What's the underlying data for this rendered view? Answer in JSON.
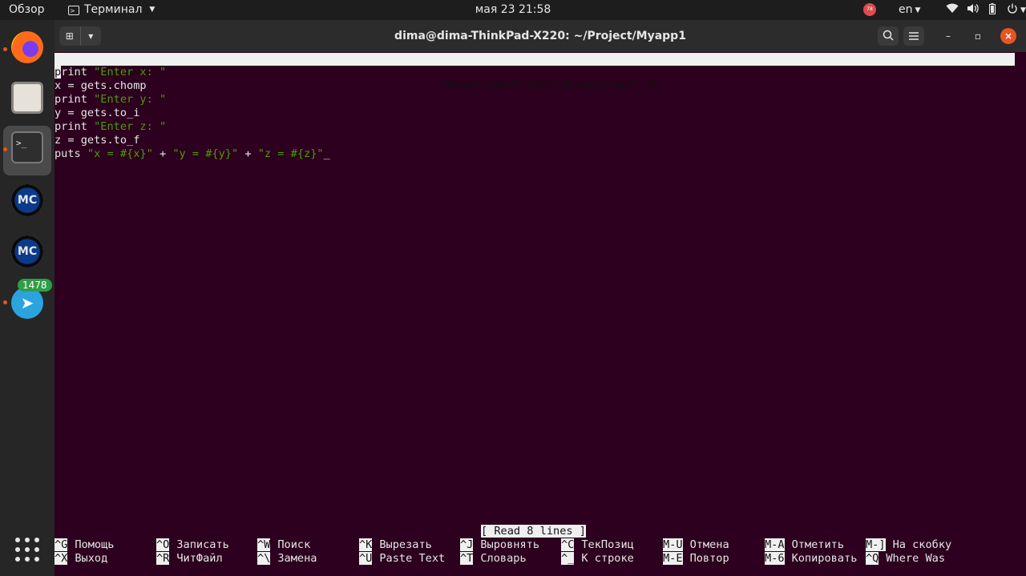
{
  "topbar": {
    "overview": "Обзор",
    "app": "Терминал",
    "clock": "мая 23  21:58",
    "rec_badge": "78",
    "lang": "en"
  },
  "dock": {
    "badge": "1478",
    "terminal_glyph": ">_",
    "mc_label": "MC"
  },
  "window": {
    "title": "dima@dima-ThinkPad-X220: ~/Project/Myapp1"
  },
  "nano": {
    "version": "GNU nano 4.8",
    "path": "/home/dima/Project/Myapp1/app7.rb",
    "status": "[ Read 8 lines ]",
    "code": [
      [
        {
          "t": "print",
          "c": "kw"
        },
        {
          "t": " \"Enter x: \"",
          "c": "str"
        }
      ],
      [
        {
          "t": "x = gets.chomp",
          "c": "kw"
        }
      ],
      [
        {
          "t": "print",
          "c": "kw"
        },
        {
          "t": " \"Enter y: \"",
          "c": "str"
        }
      ],
      [
        {
          "t": "y = gets.to_i",
          "c": "kw"
        }
      ],
      [
        {
          "t": "print",
          "c": "kw"
        },
        {
          "t": " \"Enter z: \"",
          "c": "str"
        }
      ],
      [
        {
          "t": "z = gets.to_f",
          "c": "kw"
        }
      ],
      [
        {
          "t": "puts ",
          "c": "kw"
        },
        {
          "t": "\"x = #{x}\"",
          "c": "str"
        },
        {
          "t": " + ",
          "c": "kw"
        },
        {
          "t": "\"y = #{y}\"",
          "c": "str"
        },
        {
          "t": " + ",
          "c": "kw"
        },
        {
          "t": "\"z = #{z}\"",
          "c": "str"
        },
        {
          "t": "_",
          "c": "kw"
        }
      ]
    ],
    "shortcuts_row1": [
      {
        "key": "^G",
        "label": "Помощь"
      },
      {
        "key": "^O",
        "label": "Записать"
      },
      {
        "key": "^W",
        "label": "Поиск"
      },
      {
        "key": "^K",
        "label": "Вырезать"
      },
      {
        "key": "^J",
        "label": "Выровнять"
      },
      {
        "key": "^C",
        "label": "ТекПозиц"
      },
      {
        "key": "M-U",
        "label": "Отмена"
      },
      {
        "key": "M-A",
        "label": "Отметить"
      },
      {
        "key": "M-]",
        "label": "На скобку"
      }
    ],
    "shortcuts_row2": [
      {
        "key": "^X",
        "label": "Выход"
      },
      {
        "key": "^R",
        "label": "ЧитФайл"
      },
      {
        "key": "^\\",
        "label": "Замена"
      },
      {
        "key": "^U",
        "label": "Paste Text"
      },
      {
        "key": "^T",
        "label": "Словарь"
      },
      {
        "key": "^_",
        "label": "К строке"
      },
      {
        "key": "M-E",
        "label": "Повтор"
      },
      {
        "key": "M-6",
        "label": "Копировать"
      },
      {
        "key": "^Q",
        "label": "Where Was"
      }
    ]
  }
}
